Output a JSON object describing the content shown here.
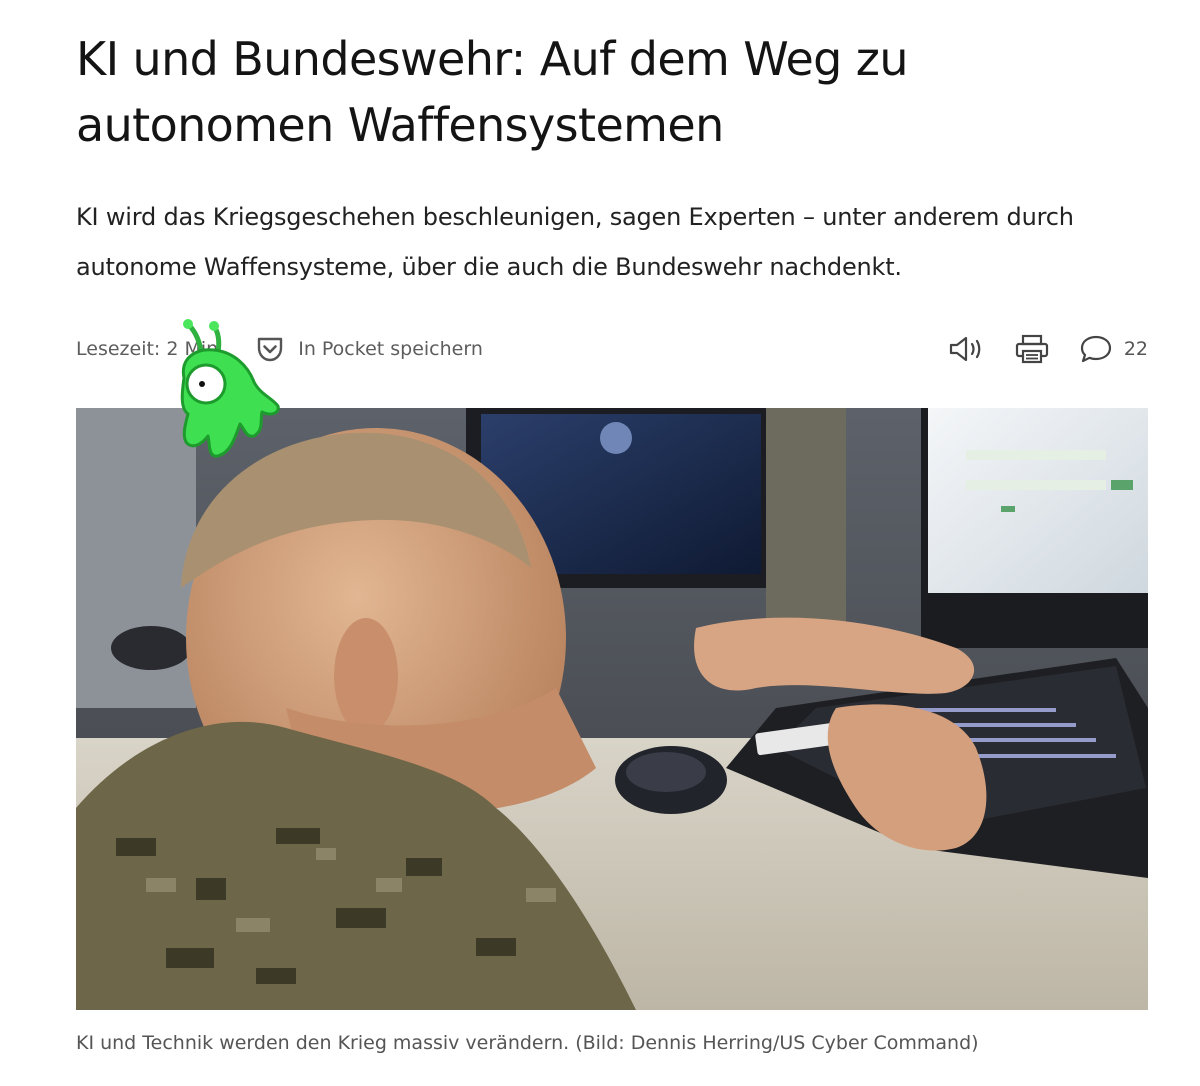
{
  "article": {
    "title": "KI und Bundeswehr: Auf dem Weg zu autonomen Waffensystemen",
    "lead": "KI wird das Kriegsgeschehen beschleunigen, sagen Experten – unter anderem durch autonome Waffensysteme, über die auch die Bundeswehr nachdenkt.",
    "read_time_label": "Lesezeit:",
    "read_time_value": "2 Min.",
    "pocket_label": "In Pocket speichern",
    "comment_count": "22",
    "caption": "KI und Technik werden den Krieg massiv verändern. (Bild: Dennis Herring/US Cyber Command)"
  },
  "icons": {
    "pocket": "pocket-icon",
    "audio": "speaker-icon",
    "print": "printer-icon",
    "comments": "speech-bubble-icon",
    "mascot": "green-alien-mascot"
  },
  "colors": {
    "text": "#141414",
    "meta": "#5d5d5d",
    "mascot": "#3ee052"
  }
}
